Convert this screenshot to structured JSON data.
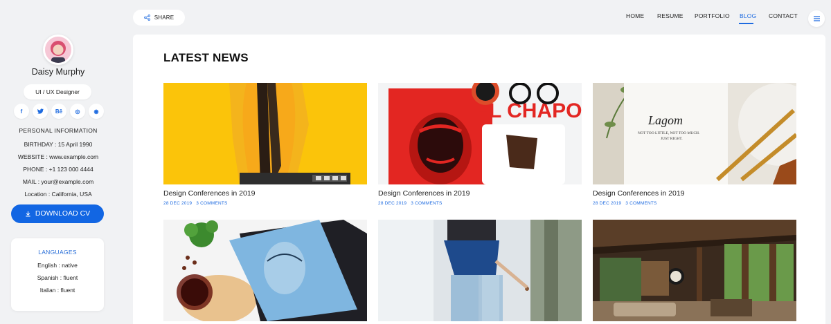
{
  "profile": {
    "name": "Daisy Murphy",
    "role": "UI / UX Designer"
  },
  "socials": [
    {
      "icon": "facebook-icon",
      "glyph": "f"
    },
    {
      "icon": "twitter-icon",
      "glyph": "t"
    },
    {
      "icon": "behance-icon",
      "glyph": "Bē"
    },
    {
      "icon": "dribbble-icon",
      "glyph": "◎"
    },
    {
      "icon": "github-icon",
      "glyph": "◉"
    }
  ],
  "personal": {
    "title": "PERSONAL INFORMATION",
    "items": [
      "BIRTHDAY : 15 April 1990",
      "WEBSITE : www.example.com",
      "PHONE : +1 123 000 4444",
      "MAIL : your@example.com",
      "Location : California, USA"
    ]
  },
  "download": {
    "label": "DOWNLOAD CV",
    "icon": "download-icon"
  },
  "languages": {
    "title": "LANGUAGES",
    "items": [
      "English : native",
      "Spanish : fluent",
      "Italian : fluent"
    ]
  },
  "header": {
    "share_label": "SHARE",
    "nav": [
      {
        "label": "HOME",
        "active": false
      },
      {
        "label": "RESUME",
        "active": false
      },
      {
        "label": "PORTFOLIO",
        "active": false
      },
      {
        "label": "BLOG",
        "active": true
      },
      {
        "label": "CONTACT",
        "active": false
      }
    ],
    "menu_icon": "hamburger-menu-icon"
  },
  "main": {
    "title": "LATEST NEWS",
    "posts": [
      {
        "title": "Design Conferences in 2019",
        "date": "28 DEC 2019",
        "comments": "3 COMMENTS"
      },
      {
        "title": "Design Conferences in 2019",
        "date": "28 DEC 2019",
        "comments": "3 COMMENTS"
      },
      {
        "title": "Design Conferences in 2019",
        "date": "28 DEC 2019",
        "comments": "3 COMMENTS"
      }
    ],
    "image_text": {
      "magazine": "EL CHAPO",
      "lagom": "Lagom",
      "lagom_sub1": "NOT TOO LITTLE, NOT TOO MUCH.",
      "lagom_sub2": "JUST RIGHT."
    }
  },
  "colors": {
    "accent": "#1e6be0",
    "download_bg": "#1266e3"
  }
}
